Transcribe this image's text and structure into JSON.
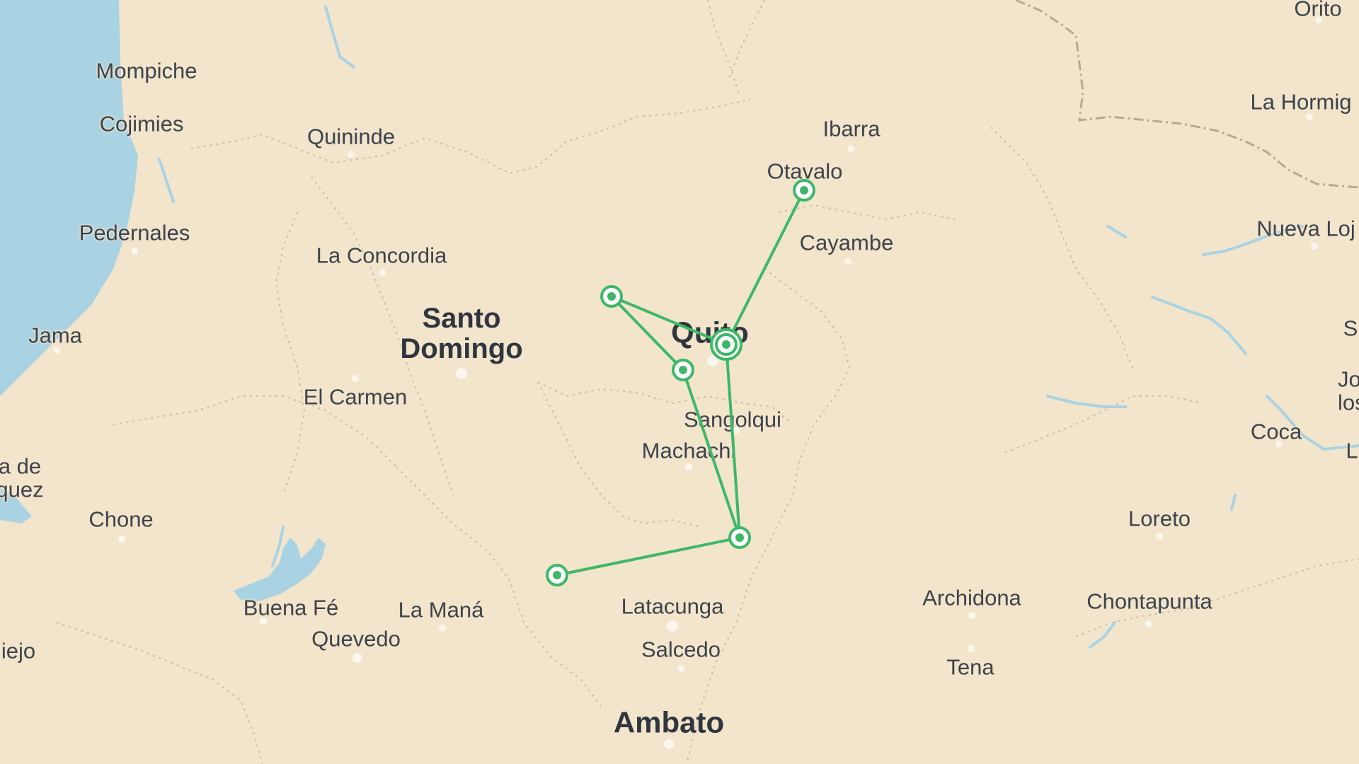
{
  "map": {
    "colors": {
      "land": "#f2e5cc",
      "water": "#a9d3e3",
      "route": "#3eb868",
      "node_fill": "#ffffff",
      "label": "#3d434c"
    },
    "places": [
      {
        "id": "orito",
        "name": "Orito"
      },
      {
        "id": "mompiche",
        "name": "Mompiche"
      },
      {
        "id": "cojimies",
        "name": "Cojimies"
      },
      {
        "id": "quininde",
        "name": "Quininde"
      },
      {
        "id": "ibarra",
        "name": "Ibarra"
      },
      {
        "id": "la-hormiga",
        "name": "La Hormig"
      },
      {
        "id": "otavalo",
        "name": "Otavalo"
      },
      {
        "id": "pedernales",
        "name": "Pedernales"
      },
      {
        "id": "la-concordia",
        "name": "La Concordia"
      },
      {
        "id": "cayambe",
        "name": "Cayambe"
      },
      {
        "id": "nueva-loja",
        "name": "Nueva Loj"
      },
      {
        "id": "jama",
        "name": "Jama"
      },
      {
        "id": "santo-domingo",
        "name": "Santo Domingo"
      },
      {
        "id": "quito",
        "name": "Quito"
      },
      {
        "id": "s-edge",
        "name": "S"
      },
      {
        "id": "jo-edge",
        "name": "Jo los"
      },
      {
        "id": "el-carmen",
        "name": "El Carmen"
      },
      {
        "id": "sangolqui",
        "name": "Sangolqui"
      },
      {
        "id": "coca",
        "name": "Coca"
      },
      {
        "id": "l-edge",
        "name": "L"
      },
      {
        "id": "machachi",
        "name": "Machachi"
      },
      {
        "id": "ade-quez",
        "name": "a de quez"
      },
      {
        "id": "chone",
        "name": "Chone"
      },
      {
        "id": "loreto",
        "name": "Loreto"
      },
      {
        "id": "archidona",
        "name": "Archidona"
      },
      {
        "id": "chontapunta",
        "name": "Chontapunta"
      },
      {
        "id": "buena-fe",
        "name": "Buena Fé"
      },
      {
        "id": "la-mana",
        "name": "La Maná"
      },
      {
        "id": "latacunga",
        "name": "Latacunga"
      },
      {
        "id": "quevedo",
        "name": "Quevedo"
      },
      {
        "id": "iejo",
        "name": "iejo"
      },
      {
        "id": "salcedo",
        "name": "Salcedo"
      },
      {
        "id": "tena",
        "name": "Tena"
      },
      {
        "id": "ambato",
        "name": "Ambato"
      }
    ],
    "route": {
      "stops": 7,
      "edges": [
        [
          "otavalo-stop",
          "quito-stop"
        ],
        [
          "west-stop",
          "quito-stop"
        ],
        [
          "west-stop",
          "south-quito-stop"
        ],
        [
          "south-quito-stop",
          "lasso-stop"
        ],
        [
          "quito-stop",
          "lasso-stop"
        ],
        [
          "lasso-stop",
          "la-mana-stop"
        ]
      ]
    }
  }
}
